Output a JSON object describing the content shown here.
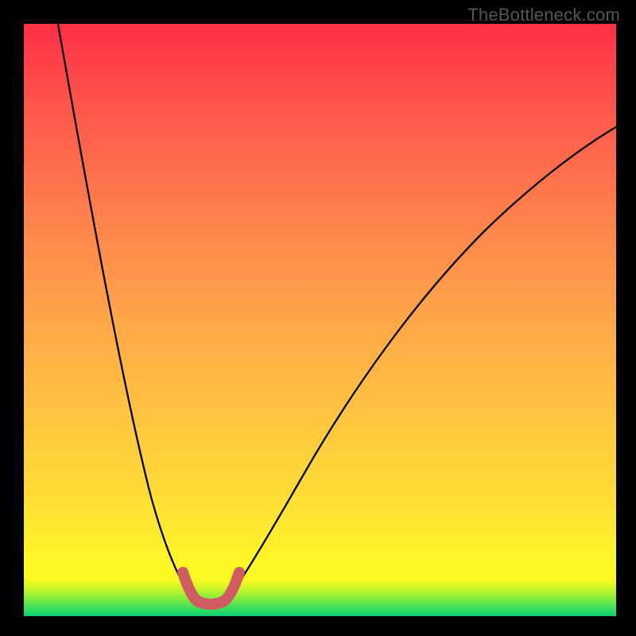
{
  "watermark": "TheBottleneck.com",
  "colors": {
    "background": "#000000",
    "gradient_top": "#ff2f47",
    "gradient_mid": "#ffd837",
    "gradient_bottom": "#07d270",
    "curve": "#000000",
    "highlight": "#cf5c62",
    "watermark_text": "#565656"
  },
  "chart_data": {
    "type": "line",
    "title": "",
    "xlabel": "",
    "ylabel": "",
    "xlim": [
      0,
      100
    ],
    "ylim": [
      0,
      100
    ],
    "grid": false,
    "legend": false,
    "series": [
      {
        "name": "bottleneck-curve",
        "x": [
          5,
          10,
          15,
          20,
          25,
          27,
          30,
          32,
          34,
          36,
          40,
          45,
          50,
          55,
          60,
          65,
          70,
          75,
          80,
          85,
          90,
          95,
          100
        ],
        "y": [
          100,
          82,
          62,
          42,
          20,
          10,
          3,
          1,
          1,
          3,
          11,
          22,
          33,
          43,
          52,
          59,
          65,
          71,
          76,
          80,
          83,
          85,
          86
        ]
      }
    ],
    "annotations": [
      {
        "name": "optimal-region",
        "x_range": [
          27,
          36
        ],
        "y_range": [
          1,
          10
        ],
        "style": "thick-highlight"
      }
    ],
    "background_gradient": {
      "direction": "vertical",
      "stops": [
        {
          "pos": 0.0,
          "color": "#07d270"
        },
        {
          "pos": 0.06,
          "color": "#f7f820"
        },
        {
          "pos": 0.5,
          "color": "#ffae46"
        },
        {
          "pos": 1.0,
          "color": "#ff2f47"
        }
      ]
    }
  }
}
